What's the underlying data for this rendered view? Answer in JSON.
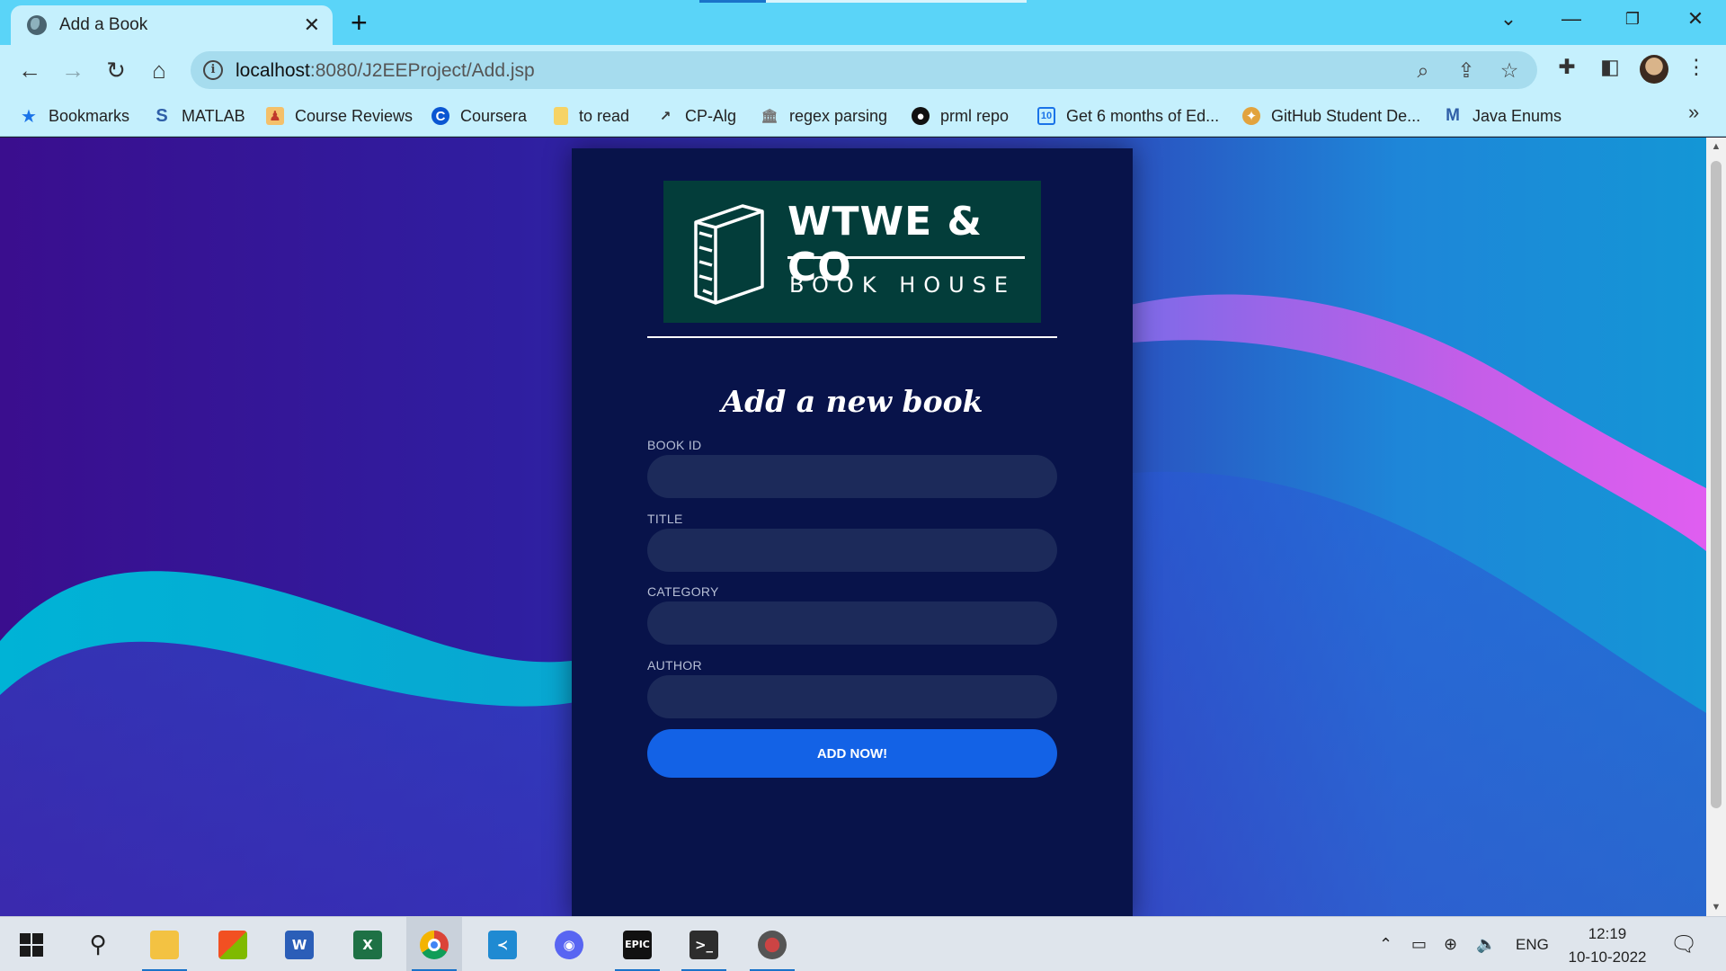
{
  "browser": {
    "tab_title": "Add a Book",
    "url_host": "localhost",
    "url_rest": ":8080/J2EEProject/Add.jsp",
    "bookmarks": [
      {
        "label": "Bookmarks",
        "icon": "star-icon",
        "color": "#1a73e8"
      },
      {
        "label": "MATLAB",
        "icon": "matlab-icon",
        "color": "#2f5fa8"
      },
      {
        "label": "Course Reviews",
        "icon": "course-reviews-icon",
        "color": "#e8590c"
      },
      {
        "label": "Coursera",
        "icon": "coursera-icon",
        "color": "#0a56d2"
      },
      {
        "label": "to read",
        "icon": "folder-icon",
        "color": "#f6d365"
      },
      {
        "label": "CP-Alg",
        "icon": "chart-icon",
        "color": "#333333"
      },
      {
        "label": "regex parsing",
        "icon": "building-icon",
        "color": "#666666"
      },
      {
        "label": "prml repo",
        "icon": "github-icon",
        "color": "#111111"
      },
      {
        "label": "Get 6 months of Ed...",
        "icon": "calendar-icon",
        "color": "#1a73e8"
      },
      {
        "label": "GitHub Student De...",
        "icon": "shell-icon",
        "color": "#e2a33d"
      },
      {
        "label": "Java Enums",
        "icon": "gmail-icon",
        "color": "#2f5fa8"
      }
    ]
  },
  "page": {
    "logo_brand": "WTWE & CO",
    "logo_sub": "BOOK HOUSE",
    "form_title": "Add a new book",
    "fields": [
      {
        "label": "BOOK ID",
        "value": ""
      },
      {
        "label": "TITLE",
        "value": ""
      },
      {
        "label": "CATEGORY",
        "value": ""
      },
      {
        "label": "AUTHOR",
        "value": ""
      }
    ],
    "submit_label": "ADD NOW!"
  },
  "taskbar": {
    "apps": [
      "windows-start",
      "search",
      "file-explorer",
      "microsoft-store",
      "word",
      "excel",
      "chrome",
      "vscode",
      "discord",
      "epic-games",
      "terminal",
      "game-launcher"
    ],
    "tray_lang": "ENG",
    "time": "12:19",
    "date": "10-10-2022",
    "epic_label": "EPIC",
    "word_label": "W",
    "excel_label": "X"
  }
}
